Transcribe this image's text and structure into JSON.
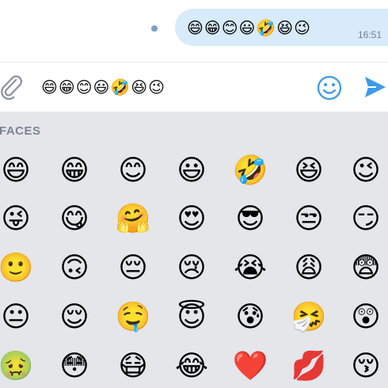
{
  "chat": {
    "message": {
      "text": "😄😁😊😃🤣😆😉",
      "time": "16:51"
    }
  },
  "composer": {
    "text": "😄😁😊😃🤣😆😉",
    "attach_icon": "paperclip-icon",
    "emoji_icon": "smiley-face-icon",
    "send_icon": "send-arrow-icon",
    "accent_color": "#3d9be9"
  },
  "emoji_keyboard": {
    "section_title": "FACES",
    "rows": [
      [
        "😄",
        "😁",
        "😊",
        "😃",
        "🤣",
        "😆",
        "😉"
      ],
      [
        "😜",
        "😋",
        "🤗",
        "😍",
        "😎",
        "😒",
        "😏"
      ],
      [
        "🙂",
        "🙃",
        "😔",
        "😢",
        "😭",
        "😩",
        "😨"
      ],
      [
        "😐",
        "😌",
        "🤤",
        "😇",
        "😰",
        "🤧",
        "😲"
      ],
      [
        "🤢",
        "😳",
        "😷",
        "😂",
        "❤️",
        "💋",
        "😚"
      ]
    ]
  }
}
